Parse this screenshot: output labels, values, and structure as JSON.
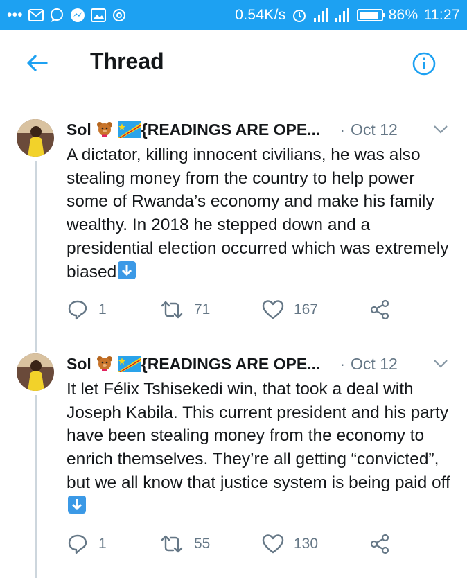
{
  "status_bar": {
    "more": "•••",
    "speed": "0.54K/s",
    "battery": "86%",
    "time": "11:27"
  },
  "header": {
    "title": "Thread"
  },
  "tweets": [
    {
      "name": "Sol",
      "handle_suffix": "{READINGS ARE OPE...",
      "dot": "·",
      "date": "Oct 12",
      "text": "A dictator, killing innocent civilians, he was also stealing money from the country to help power some of Rwanda’s economy and make his family wealthy. In 2018 he stepped down and a presidential election occurred which was extremely biased",
      "replies": "1",
      "retweets": "71",
      "likes": "167"
    },
    {
      "name": "Sol",
      "handle_suffix": "{READINGS ARE OPE...",
      "dot": "·",
      "date": "Oct 12",
      "text": "It let Félix Tshisekedi win, that took a deal with Joseph Kabila. This current president and his party have been stealing money from the economy to enrich themselves. They’re all getting “convicted”, but we all know that justice system is being paid off",
      "replies": "1",
      "retweets": "55",
      "likes": "130"
    }
  ],
  "icons": {
    "back": "arrow-left-icon",
    "info": "info-icon",
    "chevron": "chevron-down-icon",
    "reply": "reply-icon",
    "retweet": "retweet-icon",
    "like": "heart-icon",
    "share": "share-icon"
  },
  "colors": {
    "status_bar": "#1da1f2",
    "accent": "#1da1f2",
    "secondary_text": "#657786"
  }
}
